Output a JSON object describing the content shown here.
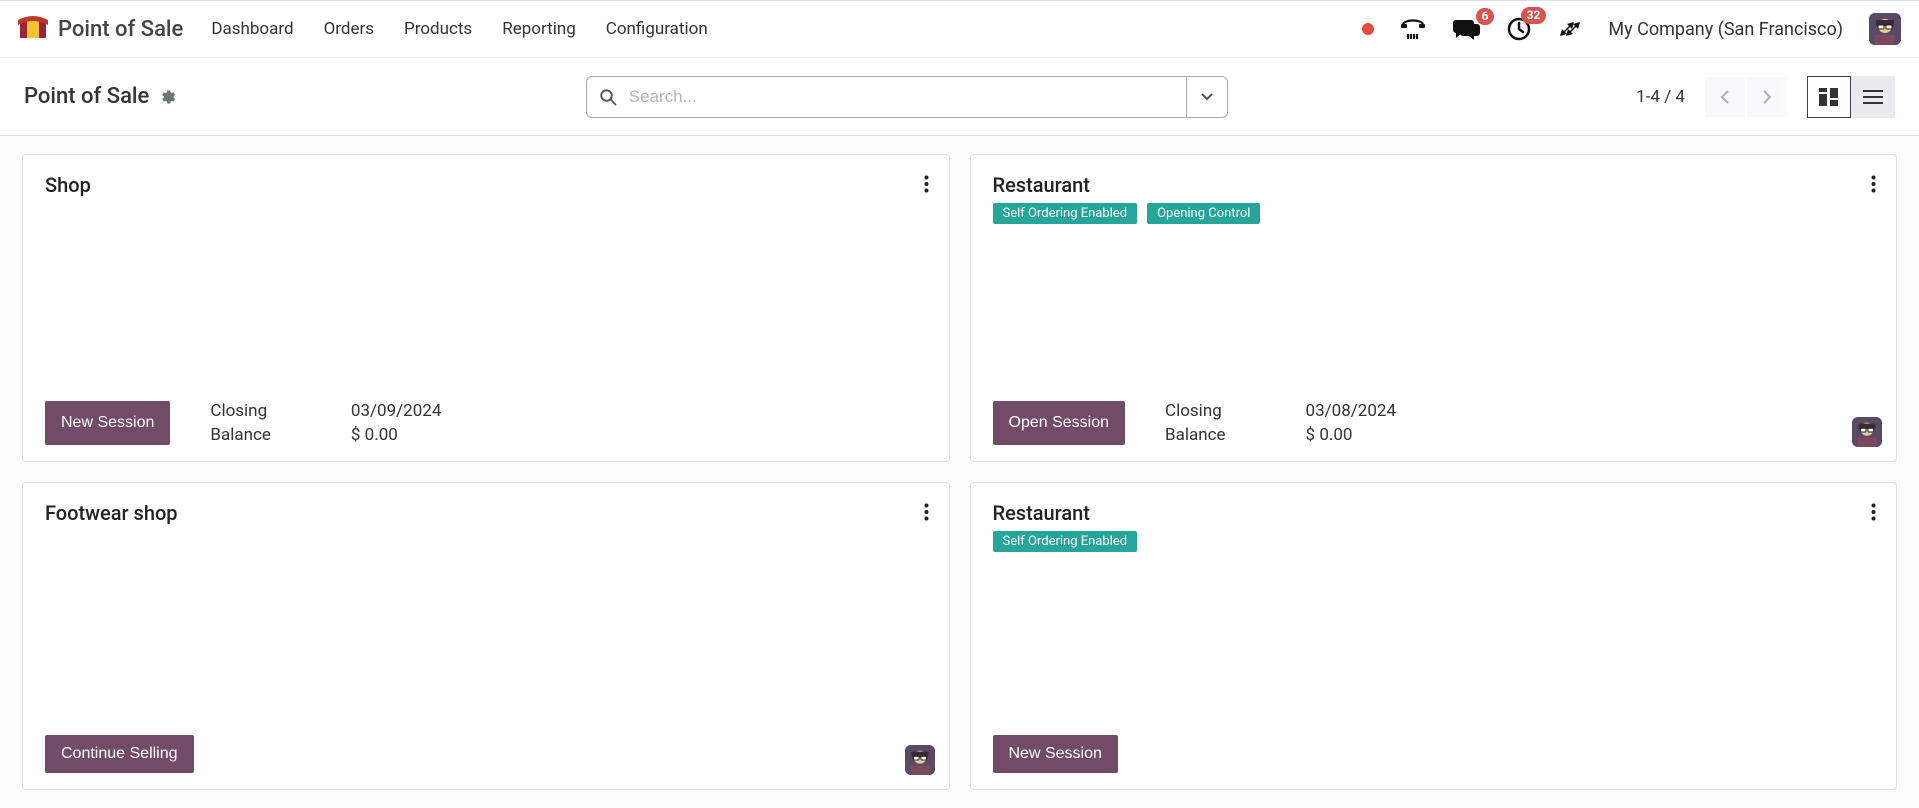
{
  "header": {
    "app_title": "Point of Sale",
    "nav": [
      "Dashboard",
      "Orders",
      "Products",
      "Reporting",
      "Configuration"
    ],
    "messages_badge": "6",
    "activities_badge": "32",
    "company": "My Company (San Francisco)"
  },
  "control": {
    "breadcrumb": "Point of Sale",
    "search_placeholder": "Search...",
    "pager": "1-4 / 4"
  },
  "cards": [
    {
      "title": "Shop",
      "tags": [],
      "button": "New Session",
      "closing_label": "Closing",
      "closing_date": "03/09/2024",
      "balance_label": "Balance",
      "balance_value": "$ 0.00",
      "show_closing": true,
      "show_avatar": false
    },
    {
      "title": "Restaurant",
      "tags": [
        "Self Ordering Enabled",
        "Opening Control"
      ],
      "button": "Open Session",
      "closing_label": "Closing",
      "closing_date": "03/08/2024",
      "balance_label": "Balance",
      "balance_value": "$ 0.00",
      "show_closing": true,
      "show_avatar": true
    },
    {
      "title": "Footwear shop",
      "tags": [],
      "button": "Continue Selling",
      "show_closing": false,
      "show_avatar": true
    },
    {
      "title": "Restaurant",
      "tags": [
        "Self Ordering Enabled"
      ],
      "button": "New Session",
      "show_closing": false,
      "show_avatar": false
    }
  ]
}
